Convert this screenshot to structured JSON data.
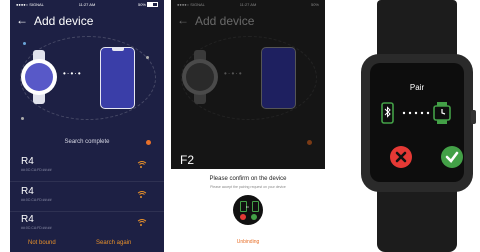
{
  "screen1": {
    "status": {
      "carrier": "●●●●○ SIGNAL",
      "time": "11:27 AM",
      "battery": "50%"
    },
    "header": {
      "back": "←",
      "title": "Add device"
    },
    "search_status": "Search complete",
    "devices": [
      {
        "name": "R4",
        "mac": "##:0C:CA:FD:##:##"
      },
      {
        "name": "R4",
        "mac": "##:0C:CA:FD:##:##"
      },
      {
        "name": "R4",
        "mac": "##:0C:CA:FD:##:##"
      }
    ],
    "footer": {
      "left": "Not bound",
      "right": "Search again"
    },
    "colors": {
      "bg": "#1d2044",
      "accent": "#e8902a"
    }
  },
  "screen2": {
    "status": {
      "carrier": "●●●●○ SIGNAL",
      "time": "11:27 AM",
      "battery": "50%"
    },
    "header": {
      "back": "←",
      "title": "Add device"
    },
    "device_name": "F2",
    "dialog": {
      "title": "Please confirm on the device",
      "subtitle": "Please accept the pairing request on your device",
      "action": "Unbinding"
    }
  },
  "watch": {
    "screen_title": "Pair",
    "icons": [
      "bluetooth-phone-icon",
      "watch-icon",
      "cancel-icon",
      "confirm-icon"
    ]
  }
}
